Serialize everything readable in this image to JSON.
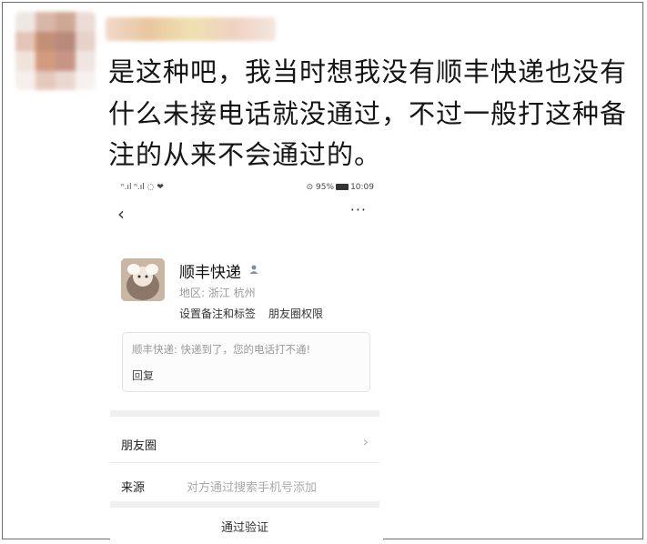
{
  "post": {
    "text": "是这种吧，我当时想我没有顺丰快递也没有什么未接电话就没通过，不过一般打这种备注的从来不会通过的。"
  },
  "phone": {
    "status_left": "ⁿ.ıl ⁿ.ıl ◌ ❤",
    "status_right_prefix": "⊙ 95%",
    "status_time": "10:09",
    "back_glyph": "‹",
    "more_glyph": "···",
    "contact": {
      "name": "顺丰快递",
      "region": "地区: 浙江 杭州",
      "link_remark": "设置备注和标签",
      "link_moments": "朋友圈权限"
    },
    "message": {
      "text": "顺丰快递: 快递到了，您的电话打不通!",
      "reply_label": "回复"
    },
    "rows": {
      "moments_label": "朋友圈",
      "source_label": "来源",
      "source_value": "对方通过搜索手机号添加"
    },
    "verify_label": "通过验证"
  }
}
